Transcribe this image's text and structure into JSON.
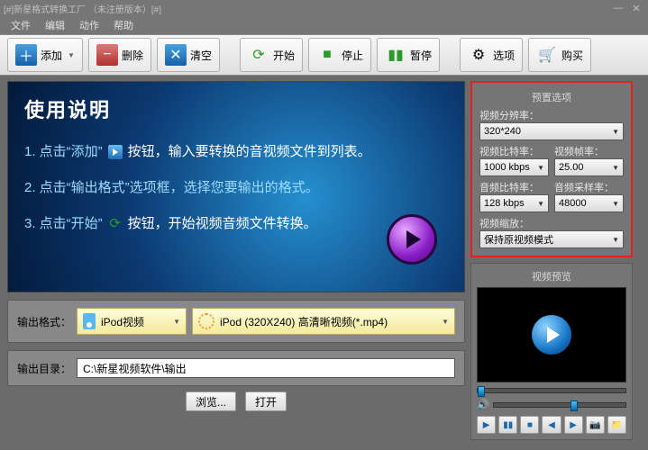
{
  "title": "[#]新星格式转换工厂 （未注册版本）[#]",
  "menu": {
    "file": "文件",
    "edit": "编辑",
    "action": "动作",
    "help": "帮助"
  },
  "toolbar": {
    "add": "添加",
    "delete": "删除",
    "clear": "清空",
    "start": "开始",
    "stop": "停止",
    "pause": "暂停",
    "options": "选项",
    "buy": "购买"
  },
  "banner": {
    "heading": "使用说明",
    "line1a": "1. 点击“添加”",
    "line1b": "按钮，输入要转换的音视频文件到列表。",
    "line2": "2. 点击“输出格式”选项框，选择您要输出的格式。",
    "line3a": "3. 点击“开始”",
    "line3b": "按钮，开始视频音频文件转换。"
  },
  "output": {
    "format_label": "输出格式：",
    "device": "iPod视频",
    "profile": "iPod (320X240) 高清晰视频(*.mp4)",
    "dir_label": "输出目录：",
    "dir_value": "C:\\新星视频软件\\输出",
    "browse": "浏览...",
    "open": "打开"
  },
  "preset": {
    "title": "预置选项",
    "res_label": "视频分辨率：",
    "res_value": "320*240",
    "vbit_label": "视频比特率：",
    "vbit_value": "1000 kbps",
    "vfps_label": "视频帧率：",
    "vfps_value": "25.00",
    "abit_label": "音频比特率：",
    "abit_value": "128 kbps",
    "asamp_label": "音频采样率：",
    "asamp_value": "48000",
    "scale_label": "视频缩放：",
    "scale_value": "保持原视频模式"
  },
  "preview": {
    "title": "视频预览"
  }
}
